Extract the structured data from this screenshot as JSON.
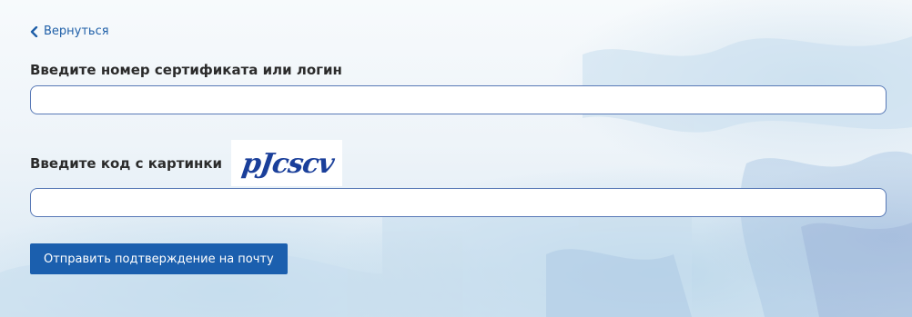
{
  "nav": {
    "back_label": "Вернуться"
  },
  "form": {
    "login_label": "Введите номер сертификата или логин",
    "login_value": "",
    "captcha_label": "Введите код с картинки",
    "captcha_text": "pJcscv",
    "captcha_value": "",
    "submit_label": "Отправить подтверждение на почту"
  },
  "colors": {
    "accent": "#1b5fae",
    "link": "#1f5fa8",
    "input_border": "#5879b6",
    "captcha_ink": "#1a3f9a"
  }
}
